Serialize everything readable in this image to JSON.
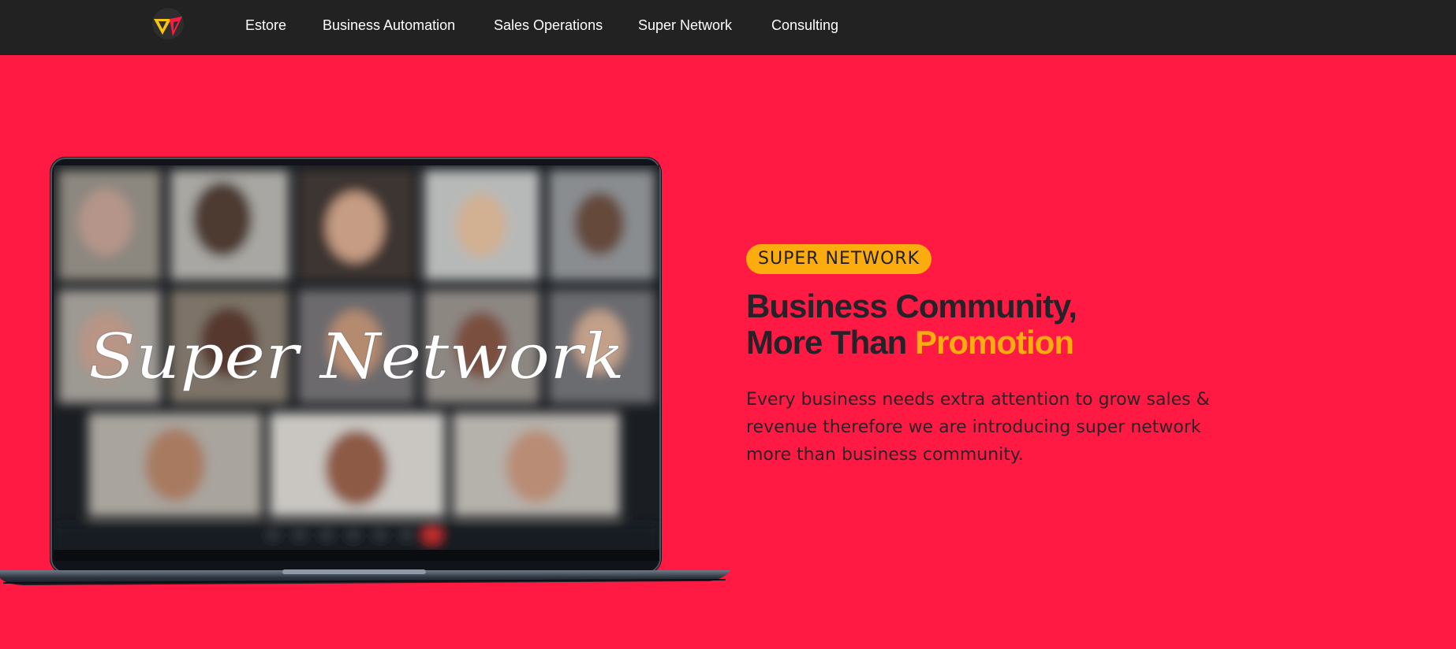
{
  "nav": {
    "items": [
      {
        "label": "Estore"
      },
      {
        "label": "Business Automation"
      },
      {
        "label": "Sales Operations"
      },
      {
        "label": "Super Network"
      },
      {
        "label": "Consulting"
      }
    ]
  },
  "logo": {
    "icon": "brand-logo-icon"
  },
  "hero": {
    "badge": "SUPER NETWORK",
    "headline_line1": "Business Community,",
    "headline_line2_prefix": "More Than",
    "headline_line2_highlight": "Promotion",
    "description": "Every business needs extra attention to grow sales & revenue therefore we are introducing super network more than business community.",
    "laptop_screen_text": "Super Network"
  },
  "colors": {
    "nav_bg": "#222222",
    "hero_bg": "#ff1a43",
    "accent": "#fcac0e",
    "headline": "#24232a",
    "nav_text": "#ffffff"
  }
}
